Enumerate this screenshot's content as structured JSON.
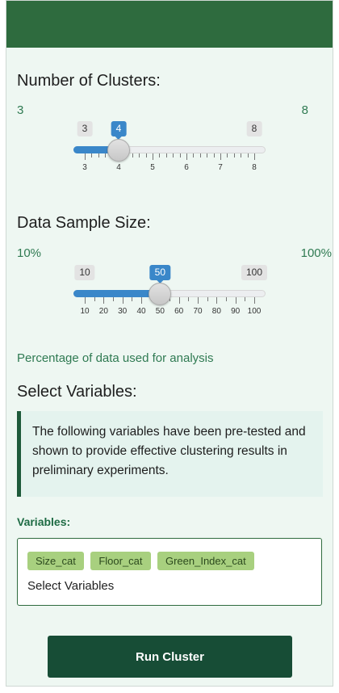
{
  "clusters": {
    "title": "Number of Clusters:",
    "range_min_label": "3",
    "range_max_label": "8",
    "min": 3,
    "max": 8,
    "value": 4,
    "bubble_min": "3",
    "bubble_value": "4",
    "bubble_max": "8",
    "ticks": [
      "3",
      "4",
      "5",
      "6",
      "7",
      "8"
    ]
  },
  "sample": {
    "title": "Data Sample Size:",
    "range_min_label": "10%",
    "range_max_label": "100%",
    "min": 10,
    "max": 100,
    "value": 50,
    "bubble_min": "10",
    "bubble_value": "50",
    "bubble_max": "100",
    "ticks": [
      "10",
      "20",
      "30",
      "40",
      "50",
      "60",
      "70",
      "80",
      "90",
      "100"
    ],
    "helper": "Percentage of data used for analysis"
  },
  "variables": {
    "section_title": "Select Variables:",
    "note": "The following variables have been pre-tested and shown to provide effective clustering results in preliminary experiments.",
    "label": "Variables:",
    "chips": [
      "Size_cat",
      "Floor_cat",
      "Green_Index_cat"
    ],
    "placeholder": "Select Variables"
  },
  "run_button": "Run Cluster",
  "colors": {
    "header": "#2e6b3e",
    "slider_accent": "#3a87c9",
    "chip": "#a8d07f",
    "button": "#174d36"
  }
}
